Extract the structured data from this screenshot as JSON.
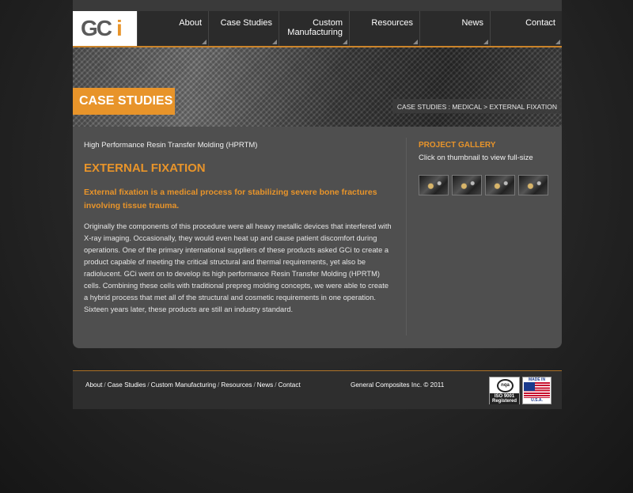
{
  "header": {
    "logo_text": "GCi",
    "nav": [
      {
        "label": "About"
      },
      {
        "label": "Case Studies"
      },
      {
        "label": "Custom\nManufacturing"
      },
      {
        "label": "Resources"
      },
      {
        "label": "News"
      },
      {
        "label": "Contact"
      }
    ]
  },
  "banner": {
    "section_label": "CASE STUDIES",
    "breadcrumb": "CASE STUDIES : MEDICAL > EXTERNAL FIXATION"
  },
  "main": {
    "subtitle": "High Performance Resin Transfer Molding (HPRTM)",
    "title": "EXTERNAL FIXATION",
    "intro": "External fixation is a medical process for stabilizing severe bone fractures involving tissue trauma.",
    "body": "Originally the components of this procedure were all heavy metallic devices that interfered with X-ray imaging. Occasionally, they would even heat up and cause patient discomfort during operations. One of the primary international suppliers of these products asked GCi to create a product capable of meeting the critical structural and thermal requirements, yet also be radiolucent. GCi went on to develop its high performance Resin Transfer Molding (HPRTM) cells. Combining these cells with traditional prepreg molding concepts, we were able to create a hybrid process that met all of the structural and cosmetic requirements in one operation. Sixteen years later, these products are still an industry standard."
  },
  "gallery": {
    "title": "PROJECT GALLERY",
    "note": "Click on thumbnail to view full-size",
    "thumbnail_count": 4
  },
  "footer": {
    "links": [
      "About",
      "Case Studies",
      "Custom Manufacturing",
      "Resources",
      "News",
      "Contact"
    ],
    "separator": "/",
    "copyright": "General Composites Inc. © 2011",
    "iso_badge": {
      "mark": "nqa",
      "text": "ISO 9001",
      "subtext": "Registered"
    },
    "usa_badge": {
      "top": "MADE IN",
      "bottom": "U.S.A."
    }
  },
  "colors": {
    "accent": "#e8942a",
    "panel": "#4f4f4f",
    "header": "#2b2b2b"
  }
}
